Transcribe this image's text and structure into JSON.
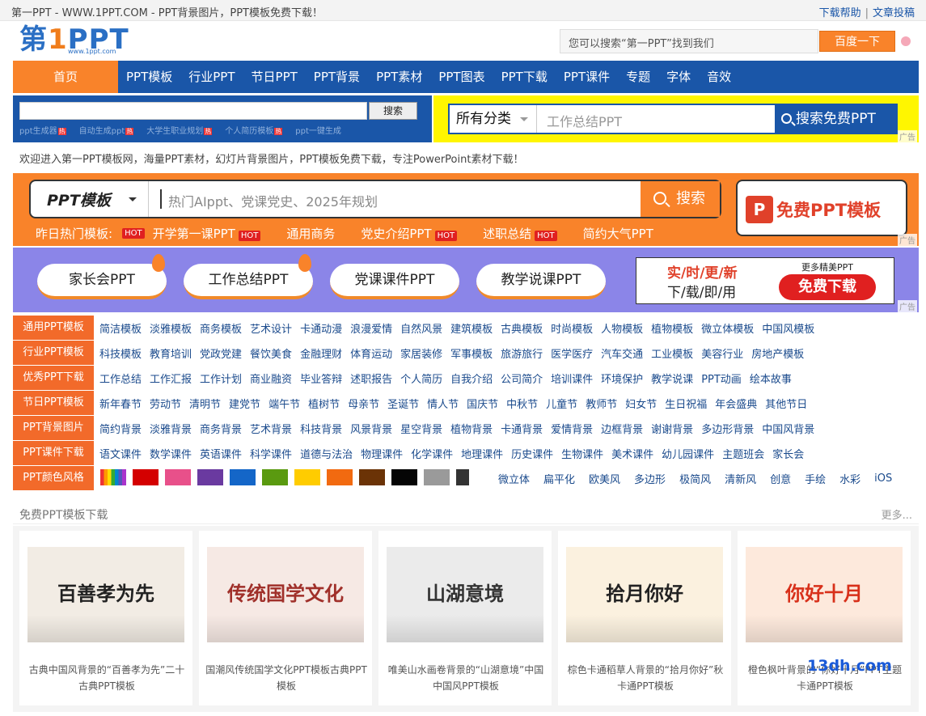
{
  "topbar": {
    "title": "第一PPT - WWW.1PPT.COM - PPT背景图片，PPT模板免费下载！",
    "help": "下载帮助",
    "sep": "|",
    "submit": "文章投稿"
  },
  "logo": {
    "text1": "第",
    "text2": "1",
    "text3": "PPT",
    "url": "www.1ppt.com"
  },
  "top_search": {
    "placeholder": "您可以搜索“第一PPT”找到我们",
    "button": "百度一下"
  },
  "nav": {
    "home": "首页",
    "items": [
      "PPT模板",
      "行业PPT",
      "节日PPT",
      "PPT背景",
      "PPT素材",
      "PPT图表",
      "PPT下载",
      "PPT课件",
      "专题",
      "字体",
      "音效"
    ]
  },
  "search1": {
    "button": "搜索",
    "keywords": [
      "ppt生成器",
      "自动生成ppt",
      "大学生职业规划",
      "个人简历模板",
      "ppt一键生成"
    ],
    "hot": "热"
  },
  "search2": {
    "category": "所有分类",
    "placeholder": "工作总结PPT",
    "button": "搜索免费PPT",
    "ad": "广告"
  },
  "welcome": "欢迎进入第一PPT模板网，海量PPT素材，幻灯片背景图片，PPT模板免费下载，专注PowerPoint素材下载！",
  "banner1": {
    "category": "PPT模板",
    "placeholder": "热门AIppt、党课党史、2025年规划",
    "button": "搜索",
    "free": "免费PPT模板",
    "free_icon": "P",
    "ad": "广告",
    "hot_label": "昨日热门模板:",
    "hot_tag": "HOT",
    "hot_items": [
      "开学第一课PPT",
      "通用商务",
      "党史介绍PPT",
      "述职总结",
      "简约大气PPT"
    ]
  },
  "banner2": {
    "pills": [
      "家长会PPT",
      "工作总结PPT",
      "党课课件PPT",
      "教学说课PPT"
    ],
    "side_a": "实/时/更/新",
    "side_b": "下/载/即/用",
    "side_c": "更多精美PPT",
    "side_btn": "免费下载",
    "ad": "广告"
  },
  "categories": [
    {
      "label": "通用PPT模板",
      "links": [
        "简洁模板",
        "淡雅模板",
        "商务模板",
        "艺术设计",
        "卡通动漫",
        "浪漫爱情",
        "自然风景",
        "建筑模板",
        "古典模板",
        "时尚模板",
        "人物模板",
        "植物模板",
        "微立体模板",
        "中国风模板"
      ]
    },
    {
      "label": "行业PPT模板",
      "links": [
        "科技模板",
        "教育培训",
        "党政党建",
        "餐饮美食",
        "金融理财",
        "体育运动",
        "家居装修",
        "军事模板",
        "旅游旅行",
        "医学医疗",
        "汽车交通",
        "工业模板",
        "美容行业",
        "房地产模板"
      ]
    },
    {
      "label": "优秀PPT下载",
      "links": [
        "工作总结",
        "工作汇报",
        "工作计划",
        "商业融资",
        "毕业答辩",
        "述职报告",
        "个人简历",
        "自我介绍",
        "公司简介",
        "培训课件",
        "环境保护",
        "教学说课",
        "PPT动画",
        "绘本故事"
      ]
    },
    {
      "label": "节日PPT模板",
      "links": [
        "新年春节",
        "劳动节",
        "清明节",
        "建党节",
        "端午节",
        "植树节",
        "母亲节",
        "圣诞节",
        "情人节",
        "国庆节",
        "中秋节",
        "儿童节",
        "教师节",
        "妇女节",
        "生日祝福",
        "年会盛典",
        "其他节日"
      ]
    },
    {
      "label": "PPT背景图片",
      "links": [
        "简约背景",
        "淡雅背景",
        "商务背景",
        "艺术背景",
        "科技背景",
        "风景背景",
        "星空背景",
        "植物背景",
        "卡通背景",
        "爱情背景",
        "边框背景",
        "谢谢背景",
        "多边形背景",
        "中国风背景"
      ]
    },
    {
      "label": "PPT课件下载",
      "links": [
        "语文课件",
        "数学课件",
        "英语课件",
        "科学课件",
        "道德与法治",
        "物理课件",
        "化学课件",
        "地理课件",
        "历史课件",
        "生物课件",
        "美术课件",
        "幼儿园课件",
        "主题班会",
        "家长会"
      ]
    }
  ],
  "colors_row": {
    "label": "PPT颜色风格",
    "swatches": [
      "#d40000",
      "#e8508a",
      "#6a3aa0",
      "#1466c8",
      "#5a9a10",
      "#ffcc00",
      "#f26a10",
      "#6b3306",
      "#050505",
      "#9a9a9a",
      "#333333"
    ],
    "styles": [
      "微立体",
      "扁平化",
      "欧美风",
      "多边形",
      "极简风",
      "清新风",
      "创意",
      "手绘",
      "水彩",
      "iOS"
    ]
  },
  "section": {
    "title": "免费PPT模板下载",
    "more": "更多..."
  },
  "cards": [
    {
      "img_text": "百善孝为先",
      "caption": "古典中国风背景的“百善孝为先”二十古典PPT模板",
      "bg": "#f2ece4",
      "fg": "#222"
    },
    {
      "img_text": "传统国学文化",
      "caption": "国潮风传统国学文化PPT模板古典PPT模板",
      "bg": "#f6e9e4",
      "fg": "#a0302a"
    },
    {
      "img_text": "山湖意境",
      "caption": "唯美山水画卷背景的“山湖意境”中国中国风PPT模板",
      "bg": "#ebebeb",
      "fg": "#333"
    },
    {
      "img_text": "拾月你好",
      "caption": "棕色卡通稻草人背景的“拾月你好”秋卡通PPT模板",
      "bg": "#fbf1df",
      "fg": "#222"
    },
    {
      "img_text": "你好十月",
      "caption": "橙色枫叶背景的“你好十月”PPT主题卡通PPT模板",
      "bg": "#fde9dc",
      "fg": "#d8301a"
    }
  ],
  "watermark": "13dh.com"
}
